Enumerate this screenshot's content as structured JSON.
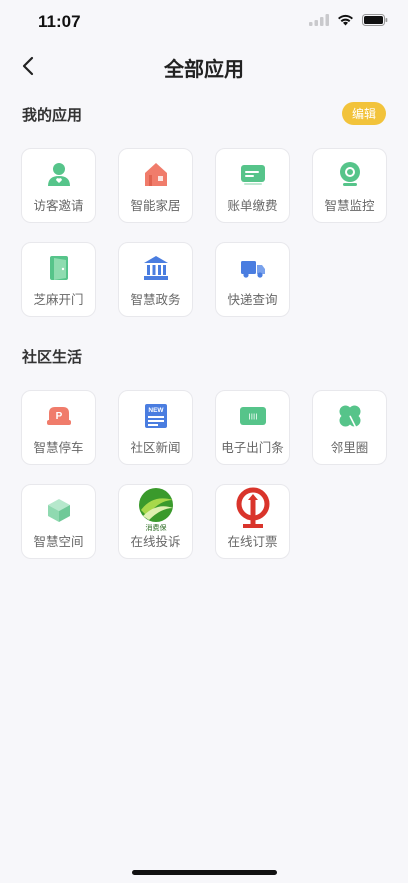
{
  "status": {
    "time": "11:07"
  },
  "nav": {
    "title": "全部应用"
  },
  "my_apps": {
    "title": "我的应用",
    "edit_label": "编辑",
    "items": [
      {
        "label": "访客邀请",
        "icon": "visitor-icon",
        "color": "#56c48a"
      },
      {
        "label": "智能家居",
        "icon": "home-icon",
        "color": "#f07c6b"
      },
      {
        "label": "账单缴费",
        "icon": "bill-icon",
        "color": "#56c48a"
      },
      {
        "label": "智慧监控",
        "icon": "camera-icon",
        "color": "#56c48a"
      },
      {
        "label": "芝麻开门",
        "icon": "door-icon",
        "color": "#56c48a"
      },
      {
        "label": "智慧政务",
        "icon": "government-icon",
        "color": "#4a7de0"
      },
      {
        "label": "快递查询",
        "icon": "delivery-truck-icon",
        "color": "#4a7de0"
      }
    ]
  },
  "community": {
    "title": "社区生活",
    "items": [
      {
        "label": "智慧停车",
        "icon": "parking-icon",
        "color": "#f07c6b",
        "badge": "P"
      },
      {
        "label": "社区新闻",
        "icon": "news-icon",
        "color": "#4a7de0",
        "badge": "NEW"
      },
      {
        "label": "电子出门条",
        "icon": "pass-ticket-icon",
        "color": "#56c48a",
        "badge": "IIII"
      },
      {
        "label": "邻里圈",
        "icon": "clover-icon",
        "color": "#56c48a"
      },
      {
        "label": "智慧空间",
        "icon": "cube-icon",
        "color": "#8fd9b0"
      },
      {
        "label": "在线投诉",
        "icon": "consumer-protection-logo-icon",
        "color": "#3a9a2c",
        "logo_text": "消费保"
      },
      {
        "label": "在线订票",
        "icon": "railway-logo-icon",
        "color": "#d9342b"
      }
    ]
  }
}
